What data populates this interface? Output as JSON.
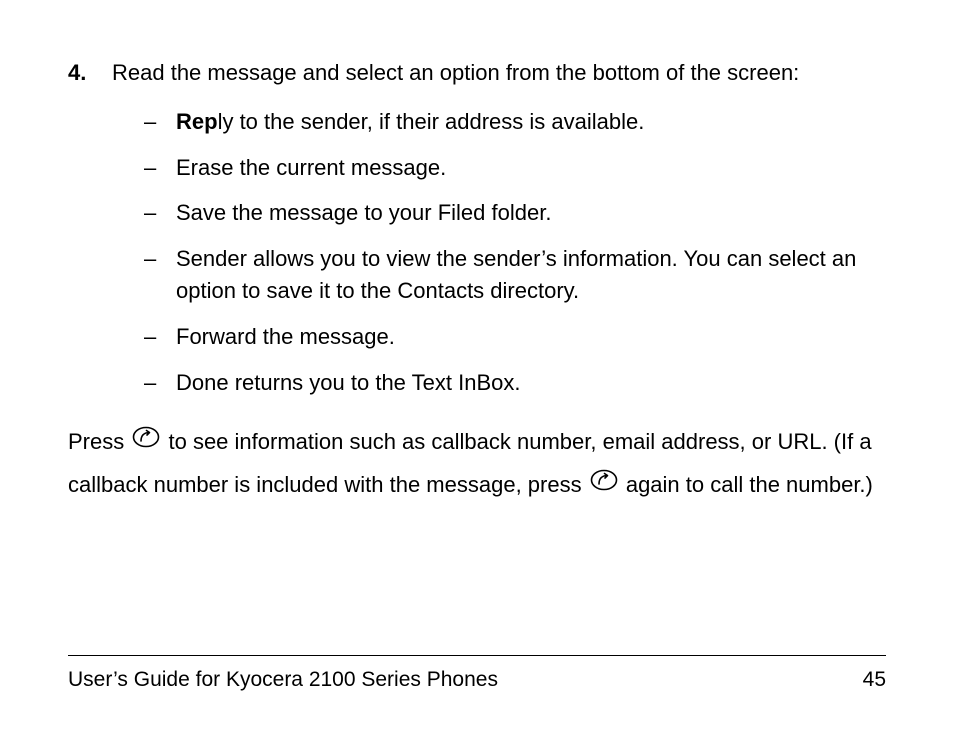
{
  "step": {
    "number": "4.",
    "text": "Read the message and select an option from the bottom of the screen:"
  },
  "bullets": {
    "dash": "–",
    "items": [
      {
        "bold_prefix": "Rep",
        "rest": "ly to the sender, if their address is available."
      },
      {
        "bold_prefix": "",
        "rest": "Erase the current message."
      },
      {
        "bold_prefix": "",
        "rest": "Save the message to your Filed folder."
      },
      {
        "bold_prefix": "",
        "rest": "Sender allows you to view the sender’s information. You can select an option to save it to the Contacts directory."
      },
      {
        "bold_prefix": "",
        "rest": "Forward the message."
      },
      {
        "bold_prefix": "",
        "rest": "Done returns you to the Text InBox."
      }
    ]
  },
  "paragraph": {
    "part1": "Press ",
    "part2": " to see information such as callback number, email address, or URL. (If a callback number is included with the message, press ",
    "part3": " again to call the number.)"
  },
  "icon": {
    "name": "call-key-icon"
  },
  "footer": {
    "title": "User’s Guide for Kyocera 2100 Series Phones",
    "page": "45"
  }
}
